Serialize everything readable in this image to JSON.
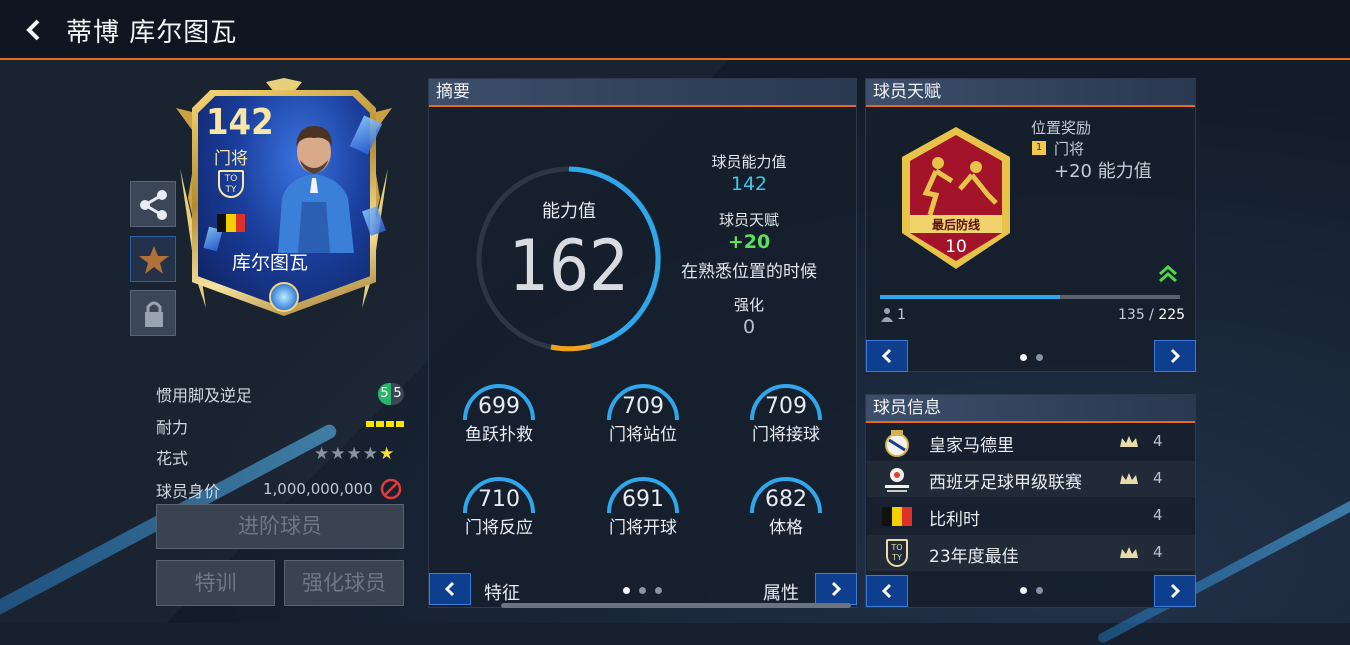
{
  "header": {
    "title": "蒂博 库尔图瓦"
  },
  "card": {
    "rating": "142",
    "position": "门将",
    "name": "库尔图瓦",
    "badge_text": "TO\nTY"
  },
  "left_stats": {
    "weak_foot_label": "惯用脚及逆足",
    "weak_foot_left": "5",
    "weak_foot_right": "5",
    "stamina_label": "耐力",
    "skill_label": "花式",
    "skill_stars": 5,
    "value_label": "球员身价",
    "value": "1,000,000,000"
  },
  "buttons": {
    "advance": "进阶球员",
    "train": "特训",
    "enhance": "强化球员"
  },
  "summary": {
    "title": "摘要",
    "gauge_label": "能力值",
    "gauge_value": "162",
    "ability_label": "球员能力值",
    "ability_value": "142",
    "talent_label": "球员天赋",
    "talent_value": "+20",
    "talent_condition": "在熟悉位置的时候",
    "enhance_label": "强化",
    "enhance_value": "0",
    "stats": [
      {
        "value": "699",
        "label": "鱼跃扑救"
      },
      {
        "value": "709",
        "label": "门将站位"
      },
      {
        "value": "709",
        "label": "门将接球"
      },
      {
        "value": "710",
        "label": "门将反应"
      },
      {
        "value": "691",
        "label": "门将开球"
      },
      {
        "value": "682",
        "label": "体格"
      }
    ],
    "footer_left": "特征",
    "footer_right": "属性"
  },
  "talent": {
    "title": "球员天赋",
    "badge_name": "最后防线",
    "badge_level": "10",
    "bonus_title": "位置奖励",
    "bonus_rank": "1",
    "bonus_position": "门将",
    "bonus_value": "+20 能力值",
    "progress_count": "1",
    "progress_current": "135",
    "progress_max": "225"
  },
  "info": {
    "title": "球员信息",
    "rows": [
      {
        "name": "皇家马德里",
        "level": "4"
      },
      {
        "name": "西班牙足球甲级联赛",
        "level": "4"
      },
      {
        "name": "比利时",
        "level": "4"
      },
      {
        "name": "23年度最佳",
        "level": "4"
      }
    ]
  },
  "colors": {
    "accent": "#e86a1e",
    "cyan": "#3fc6e6",
    "green": "#5fe05a",
    "gold": "#f2c94c"
  }
}
